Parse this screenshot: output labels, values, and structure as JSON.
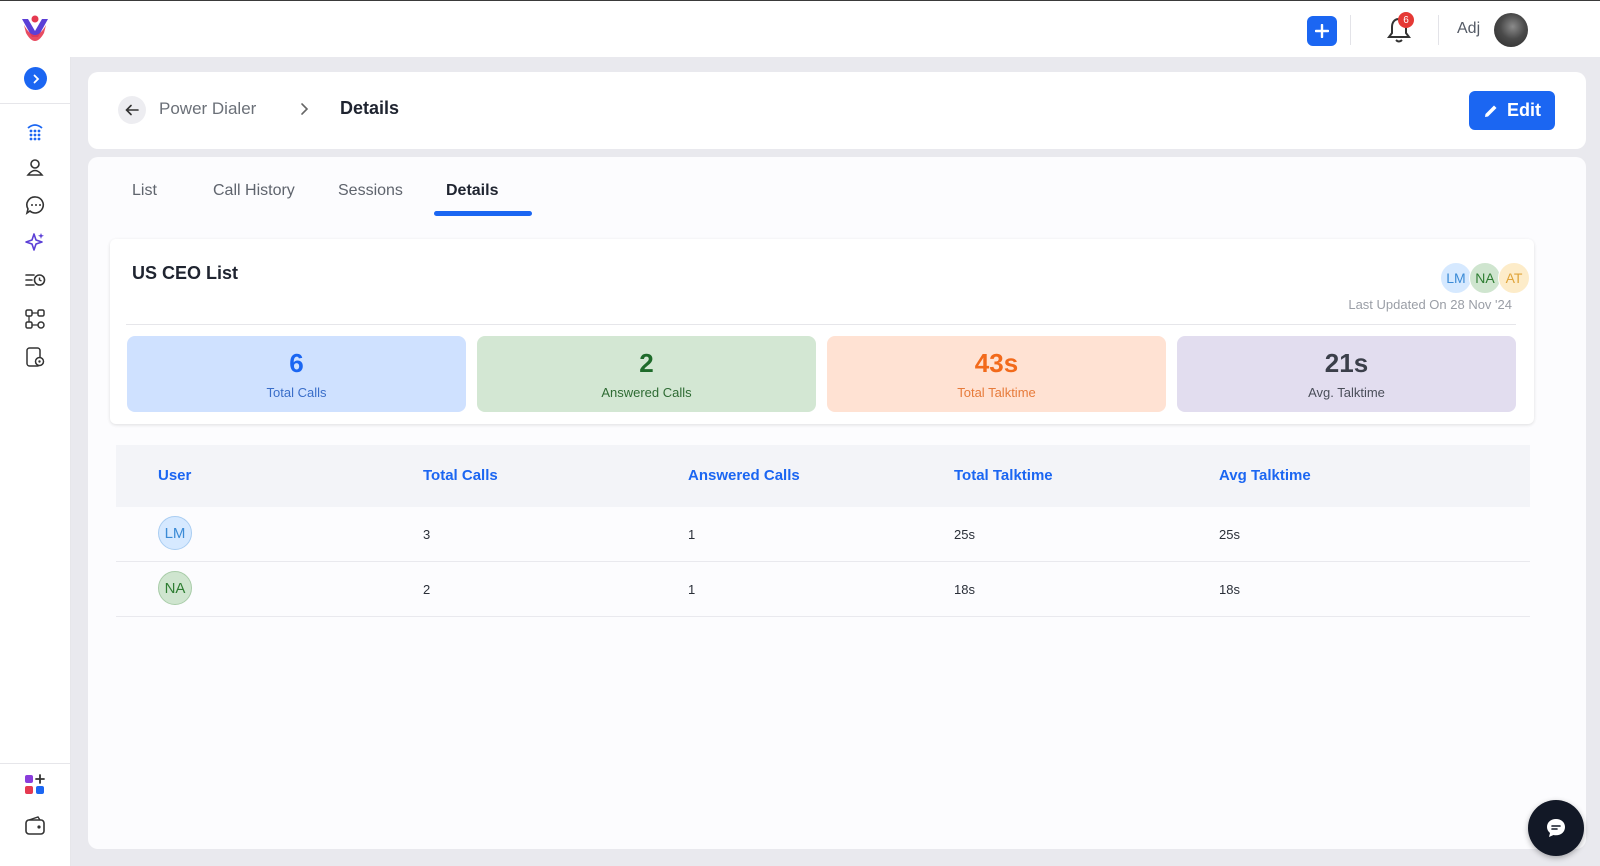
{
  "topbar": {
    "notification_count": "6",
    "user_name": "Adj"
  },
  "breadcrumb": {
    "parent": "Power Dialer",
    "current": "Details"
  },
  "header": {
    "edit_label": "Edit"
  },
  "tabs": [
    {
      "label": "List",
      "active": false
    },
    {
      "label": "Call History",
      "active": false
    },
    {
      "label": "Sessions",
      "active": false
    },
    {
      "label": "Details",
      "active": true
    }
  ],
  "list_card": {
    "title": "US CEO List",
    "members": [
      {
        "initials": "LM",
        "bg": "#d6e9ff",
        "fg": "#3b8bd6"
      },
      {
        "initials": "NA",
        "bg": "#cfe5cf",
        "fg": "#2e7d32"
      },
      {
        "initials": "AT",
        "bg": "#fdecc9",
        "fg": "#e0a43a"
      }
    ],
    "last_updated": "Last Updated On 28 Nov '24"
  },
  "stats": [
    {
      "value": "6",
      "label": "Total Calls",
      "bg": "#cfe1ff",
      "num_color": "#1b66f2",
      "lbl_color": "#3a6ec9"
    },
    {
      "value": "2",
      "label": "Answered Calls",
      "bg": "#d3e7d3",
      "num_color": "#1e6b2a",
      "lbl_color": "#2e6b33"
    },
    {
      "value": "43s",
      "label": "Total Talktime",
      "bg": "#ffe2d3",
      "num_color": "#f26a1b",
      "lbl_color": "#e77b3b"
    },
    {
      "value": "21s",
      "label": "Avg. Talktime",
      "bg": "#e2ddef",
      "num_color": "#3b3f4a",
      "lbl_color": "#4a4e59"
    }
  ],
  "table": {
    "headers": [
      "User",
      "Total Calls",
      "Answered Calls",
      "Total Talktime",
      "Avg Talktime"
    ],
    "rows": [
      {
        "user": "LM",
        "user_bg": "#d6e9ff",
        "user_fg": "#3b8bd6",
        "total_calls": "3",
        "answered_calls": "1",
        "total_talktime": "25s",
        "avg_talktime": "25s"
      },
      {
        "user": "NA",
        "user_bg": "#cfe5cf",
        "user_fg": "#2e7d32",
        "total_calls": "2",
        "answered_calls": "1",
        "total_talktime": "18s",
        "avg_talktime": "18s"
      }
    ]
  },
  "sidebar": {
    "icons": [
      "dialpad-icon",
      "contacts-icon",
      "conversations-icon",
      "ai-sparkle-icon",
      "call-queue-icon",
      "workflow-icon",
      "phone-settings-icon"
    ],
    "bottom_icons": [
      "apps-add-icon",
      "wallet-icon"
    ]
  },
  "colors": {
    "accent": "#1b66f2"
  }
}
